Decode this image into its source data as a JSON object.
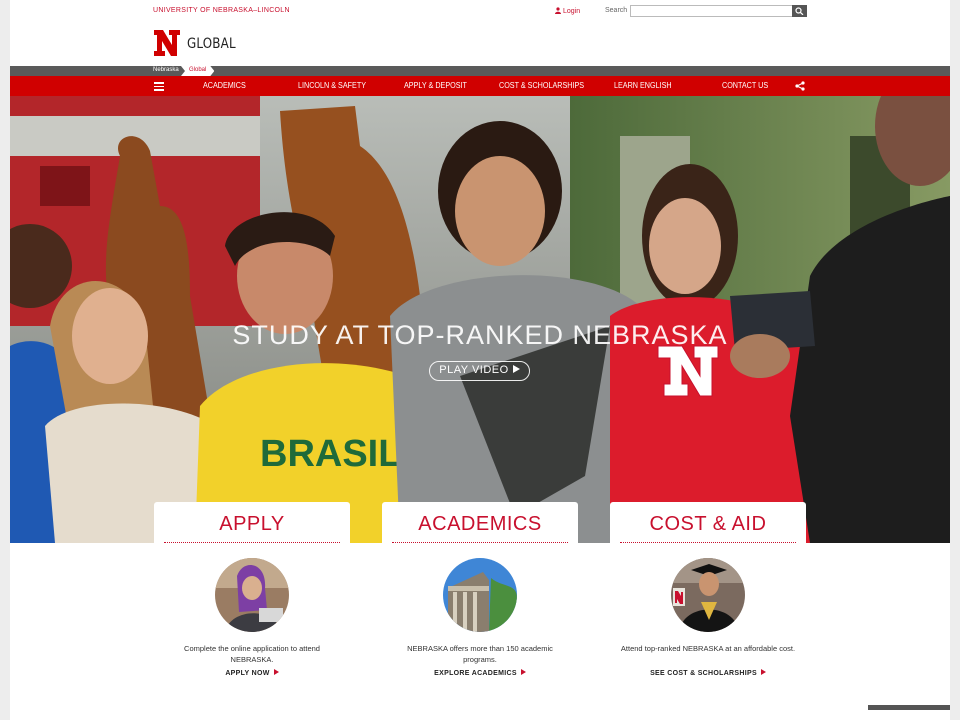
{
  "header": {
    "university": "UNIVERSITY OF NEBRASKA–LINCOLN",
    "login": "Login",
    "search_label": "Search",
    "search_placeholder": "",
    "logo_letter": "N",
    "site_name": "GLOBAL"
  },
  "breadcrumb": [
    "Nebraska",
    "Global"
  ],
  "nav": {
    "items": [
      "ACADEMICS",
      "LINCOLN & SAFETY",
      "APPLY & DEPOSIT",
      "COST & SCHOLARSHIPS",
      "LEARN ENGLISH",
      "CONTACT US"
    ]
  },
  "hero": {
    "title": "STUDY AT TOP-RANKED NEBRASKA",
    "play_label": "PLAY VIDEO",
    "shirt_text": "BRASIL"
  },
  "cards": [
    {
      "title": "APPLY",
      "text": "Complete the online application to attend NEBRASKA.",
      "link": "APPLY NOW"
    },
    {
      "title": "ACADEMICS",
      "text": "NEBRASKA offers more than 150 academic programs.",
      "link": "EXPLORE ACADEMICS"
    },
    {
      "title": "COST & AID",
      "text": "Attend top-ranked NEBRASKA at an affordable cost.",
      "link": "SEE COST & SCHOLARSHIPS"
    }
  ],
  "colors": {
    "brand_red": "#d00000",
    "accent_red": "#c8102e",
    "breadcrumb_gray": "#5a5a5a"
  },
  "icons": [
    "menu-icon",
    "share-icon",
    "search-icon",
    "user-icon",
    "play-icon"
  ]
}
